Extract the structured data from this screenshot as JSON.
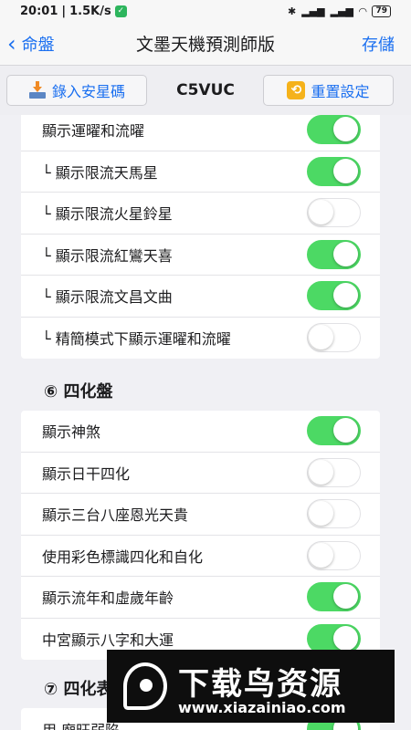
{
  "status_bar": {
    "time": "20:01",
    "speed": "1.5K/s",
    "network": "4G",
    "battery": "79"
  },
  "nav": {
    "back_label": "命盤",
    "title": "文墨天機預測師版",
    "save_label": "存儲"
  },
  "toolbar": {
    "import_label": "錄入安星碼",
    "code": "C5VUC",
    "reset_label": "重置設定"
  },
  "group1": {
    "rows": [
      {
        "label": "顯示運曜和流曜",
        "on": true
      },
      {
        "label": "└ 顯示限流天馬星",
        "on": true
      },
      {
        "label": "└ 顯示限流火星鈴星",
        "on": false
      },
      {
        "label": "└ 顯示限流紅鸞天喜",
        "on": true
      },
      {
        "label": "└ 顯示限流文昌文曲",
        "on": true
      },
      {
        "label": "└ 精簡模式下顯示運曜和流曜",
        "on": false
      }
    ]
  },
  "section6": {
    "title": "⑥ 四化盤"
  },
  "group2": {
    "rows": [
      {
        "label": "顯示神煞",
        "on": true
      },
      {
        "label": "顯示日干四化",
        "on": false
      },
      {
        "label": "顯示三台八座恩光天貴",
        "on": false
      },
      {
        "label": "使用彩色標識四化和自化",
        "on": false
      },
      {
        "label": "顯示流年和虛歲年齡",
        "on": true
      },
      {
        "label": "中宮顯示八字和大運",
        "on": true
      }
    ]
  },
  "section7": {
    "title": "⑦ 四化表"
  },
  "group3": {
    "rows": [
      {
        "label": "用  廟旺弱陷",
        "on": true
      }
    ]
  },
  "watermark": {
    "title": "下载鸟资源",
    "url": "www.xiazainiao.com"
  },
  "colors": {
    "accent": "#1a6ff0",
    "toggle_on": "#4cd964"
  }
}
